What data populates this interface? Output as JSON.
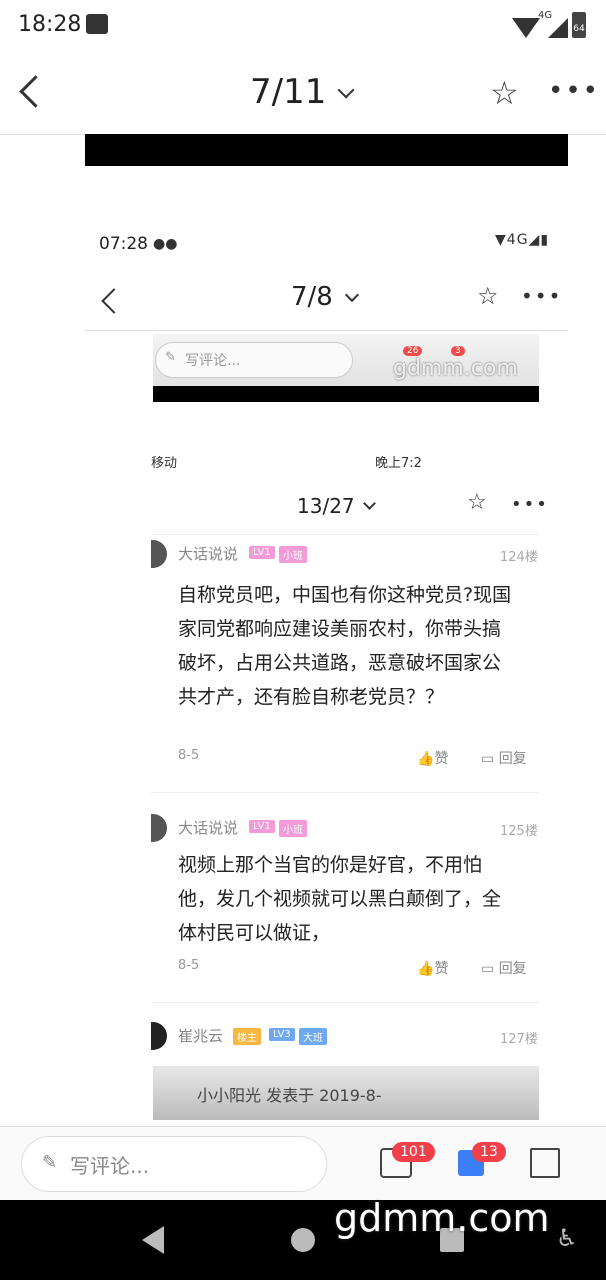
{
  "status_bar": {
    "time": "18:28",
    "network": "4G",
    "battery": "64"
  },
  "top_nav": {
    "page_indicator": "7/11"
  },
  "inner_screenshot": {
    "time": "07:28",
    "network": "4G",
    "page_indicator": "7/8",
    "comment_bar": {
      "placeholder": "写评论...",
      "comment_count": "26",
      "like_count": "3",
      "watermark": "gdmm.com"
    },
    "nested": {
      "carrier": "移动",
      "status_time": "晚上7:2",
      "page_indicator": "13/27",
      "comments": [
        {
          "user": "大话说说",
          "tags": [
            "LV1",
            "小班"
          ],
          "floor": "124楼",
          "text": "自称党员吧，中国也有你这种党员?现国家同党都响应建设美丽农村，你带头搞破坏，占用公共道路，恶意破坏国家公共才产，还有脸自称老党员？？",
          "date": "8-5",
          "like": "赞",
          "reply": "回复"
        },
        {
          "user": "大话说说",
          "tags": [
            "LV1",
            "小班"
          ],
          "floor": "125楼",
          "text": "视频上那个当官的你是好官，不用怕他，发几个视频就可以黑白颠倒了，全体村民可以做证，",
          "date": "8-5",
          "like": "赞",
          "reply": "回复"
        },
        {
          "user": "崔兆云",
          "tags": [
            "楼主",
            "LV3",
            "大班"
          ],
          "floor": "127楼"
        }
      ],
      "bottom_text": "小小阳光 发表于 2019-8-"
    }
  },
  "bottom_bar": {
    "placeholder": "写评论...",
    "comment_count": "101",
    "like_count": "13"
  },
  "watermark": "gdmm.com",
  "colors": {
    "badge": "#f2404a",
    "like": "#3b7ef5",
    "tag_pink": "#f39ad9",
    "tag_blue": "#6ea8f0",
    "tag_gold": "#f5b740"
  }
}
